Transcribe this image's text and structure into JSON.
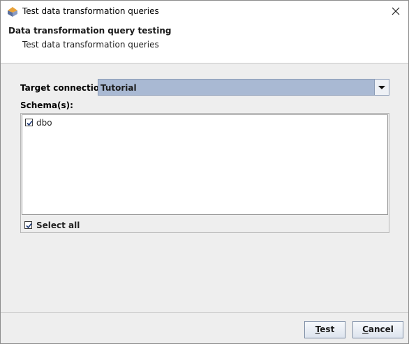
{
  "window": {
    "title": "Test data transformation queries",
    "icon": "app-logo-icon",
    "close_icon": "close-icon"
  },
  "header": {
    "title": "Data transformation query testing",
    "subtitle": "Test data transformation queries"
  },
  "form": {
    "target_connection_label": "Target connection:",
    "target_connection_value": "Tutorial",
    "schemas_label": "Schema(s):",
    "schemas": [
      {
        "label": "dbo",
        "checked": true
      }
    ],
    "select_all_label": "Select all",
    "select_all_checked": true
  },
  "buttons": {
    "test": {
      "label_mnemonic": "T",
      "label_rest": "est"
    },
    "cancel": {
      "label_mnemonic": "C",
      "label_rest": "ancel"
    }
  },
  "colors": {
    "combo_selected_bg": "#a9b9d3",
    "dialog_bg": "#eeeeee"
  }
}
